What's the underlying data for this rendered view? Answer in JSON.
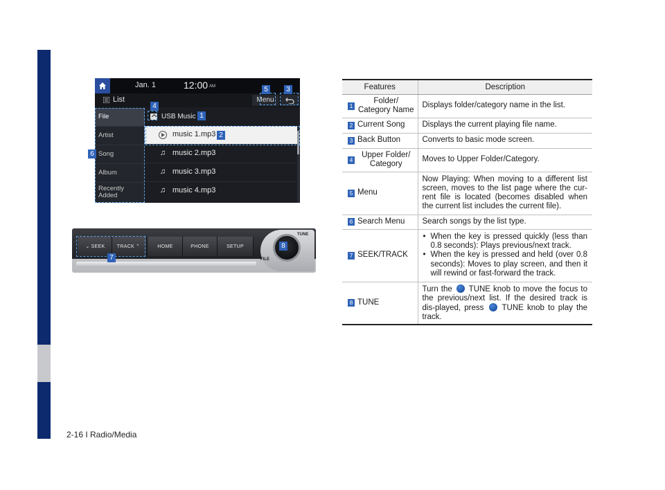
{
  "footer": {
    "page_label": "2-16 I Radio/Media"
  },
  "screen": {
    "date": "Jan.   1",
    "time": "12:00",
    "ampm": "AM",
    "list_title": "List",
    "menu_label": "Menu",
    "categories": [
      "File",
      "Artist",
      "Song",
      "Album",
      "Recently Added"
    ],
    "folder_name": "USB Music",
    "songs": [
      "music 1.mp3",
      "music 2.mp3",
      "music 3.mp3",
      "music 4.mp3"
    ]
  },
  "panel": {
    "buttons": [
      "SEEK",
      "TRACK",
      "HOME",
      "PHONE",
      "SETUP"
    ],
    "tune_label": "TUNE",
    "file_label": "FILE"
  },
  "callouts": [
    "1",
    "2",
    "3",
    "4",
    "5",
    "6",
    "7",
    "8"
  ],
  "colors": {
    "accent": "#2f63b8",
    "side_bar": "#0d2a6e",
    "focus": "#5aa0e6"
  },
  "table": {
    "headers": [
      "Features",
      "Description"
    ],
    "rows": [
      {
        "num": "1",
        "feature": "Folder/ Category Name",
        "description": "Displays folder/category name in the list."
      },
      {
        "num": "2",
        "feature": "Current Song",
        "description": "Displays the current playing file name."
      },
      {
        "num": "3",
        "feature": "Back Button",
        "description": "Converts to basic mode screen."
      },
      {
        "num": "4",
        "feature": "Upper Folder/ Category",
        "description": "Moves to Upper Folder/Category."
      },
      {
        "num": "5",
        "feature": "Menu",
        "description": "Now Playing: When moving to a different list screen, moves to the list page where the cur-rent file is located (becomes disabled when the current list includes the current file)."
      },
      {
        "num": "6",
        "feature": "Search Menu",
        "description": "Search songs by the list type."
      },
      {
        "num": "7",
        "feature": "SEEK/TRACK",
        "bullets": [
          "When the key is pressed quickly (less than 0.8 seconds): Plays previous/next track.",
          "When the key is pressed and held (over 0.8 seconds): Moves to play screen, and then it will rewind or fast-forward the track."
        ]
      },
      {
        "num": "8",
        "feature": "TUNE",
        "desc_parts": [
          "Turn the",
          "TUNE knob to move the focus to the previous/next list. If the desired track is dis-played, press",
          "TUNE knob to play the track."
        ]
      }
    ]
  }
}
